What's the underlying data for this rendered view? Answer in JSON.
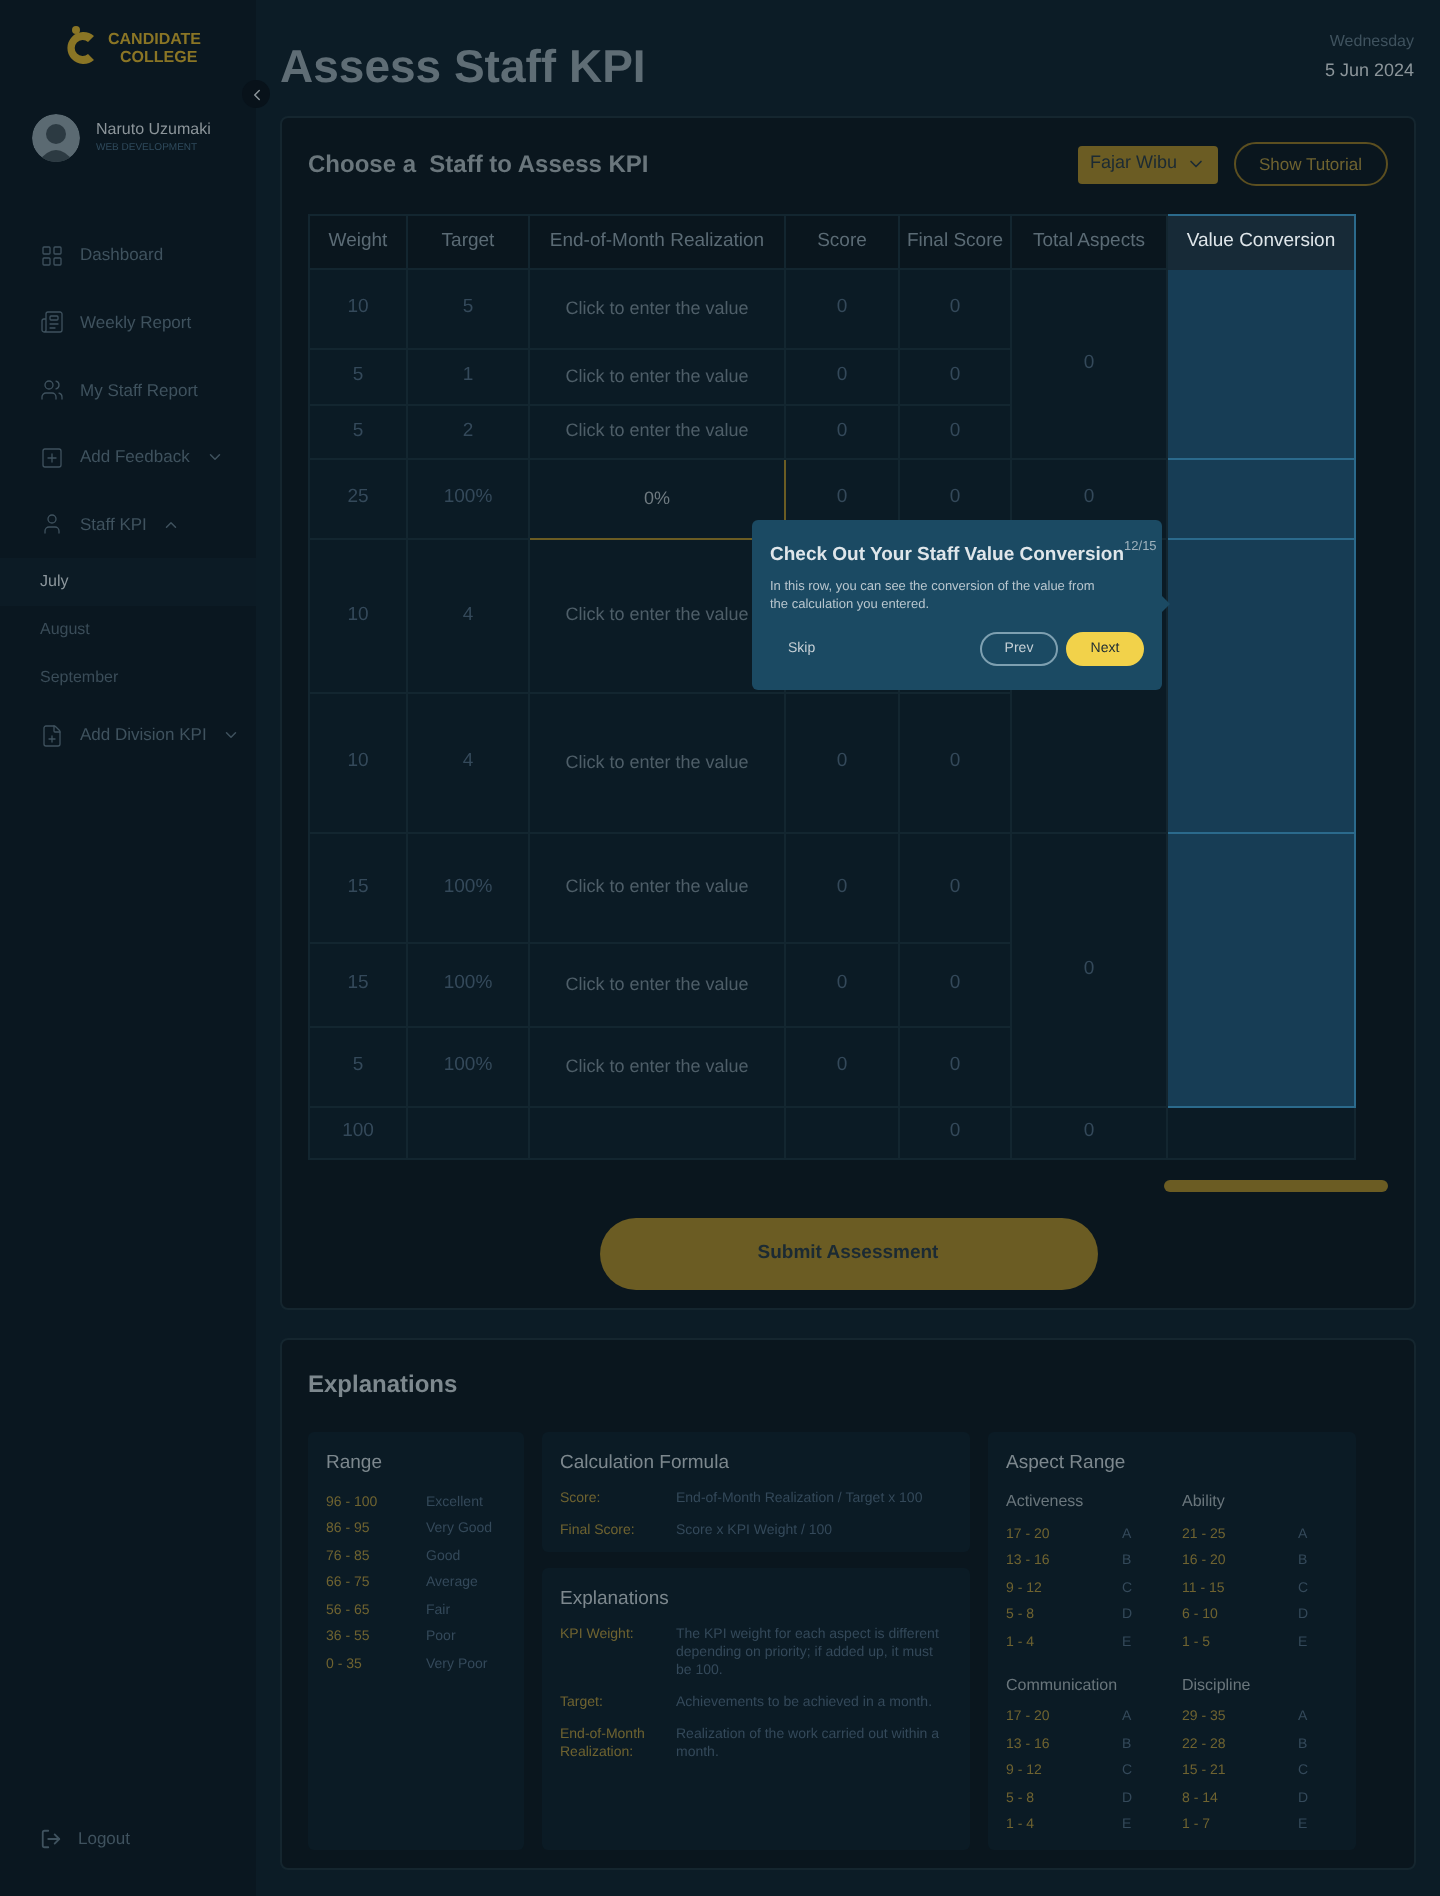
{
  "sidebar": {
    "logo": {
      "line1": "CANDIDATE",
      "line2": "COLLEGE"
    },
    "user": {
      "name": "Naruto Uzumaki",
      "role": "WEB DEVELOPMENT"
    },
    "nav": [
      {
        "kind": "link",
        "label": "Dashboard"
      },
      {
        "kind": "link",
        "label": "Weekly Report"
      },
      {
        "kind": "link",
        "label": "My Staff Report"
      },
      {
        "kind": "group",
        "label": "Add Feedback",
        "expanded": false
      },
      {
        "kind": "group",
        "label": "Staff KPI",
        "expanded": true,
        "children": [
          {
            "label": "July",
            "selected": true
          },
          {
            "label": "August",
            "selected": false
          },
          {
            "label": "September",
            "selected": false
          }
        ]
      },
      {
        "kind": "group",
        "label": "Add Division KPI",
        "expanded": false
      }
    ],
    "logout": "Logout"
  },
  "header": {
    "title": "Assess Staff KPI",
    "weekday": "Wednesday",
    "date": "5 Jun 2024"
  },
  "assess": {
    "title": "Choose a  Staff to Assess KPI",
    "staff_select": "Fajar Wibu",
    "tutorial_button": "Show Tutorial",
    "table": {
      "columns": [
        {
          "label": "Weight",
          "highlighted": false
        },
        {
          "label": "Target",
          "highlighted": false
        },
        {
          "label": "End-of-Month Realization",
          "highlighted": false
        },
        {
          "label": "Score",
          "highlighted": false
        },
        {
          "label": "Final Score",
          "highlighted": false
        },
        {
          "label": "Total Aspects",
          "highlighted": false
        },
        {
          "label": "Value Conversion",
          "highlighted": true
        }
      ],
      "groups": [
        {
          "total": "0",
          "rows": [
            {
              "weight": "10",
              "target": "5",
              "realization": "Click to enter the value",
              "focused": false,
              "score": "0",
              "final_score": "0"
            },
            {
              "weight": "5",
              "target": "1",
              "realization": "Click to enter the value",
              "focused": false,
              "score": "0",
              "final_score": "0"
            },
            {
              "weight": "5",
              "target": "2",
              "realization": "Click to enter the value",
              "focused": false,
              "score": "0",
              "final_score": "0"
            }
          ]
        },
        {
          "total": "0",
          "rows": [
            {
              "weight": "25",
              "target": "100%",
              "realization": "0%",
              "focused": true,
              "score": "0",
              "final_score": "0"
            }
          ]
        },
        {
          "rows": [
            {
              "weight": "10",
              "target": "4",
              "realization": "Click to enter the value",
              "focused": false
            },
            {
              "weight": "10",
              "target": "4",
              "realization": "Click to enter the value",
              "focused": false,
              "score": "0",
              "final_score": "0"
            }
          ]
        },
        {
          "total": "0",
          "rows": [
            {
              "weight": "15",
              "target": "100%",
              "realization": "Click to enter the value",
              "focused": false,
              "score": "0",
              "final_score": "0"
            },
            {
              "weight": "15",
              "target": "100%",
              "realization": "Click to enter the value",
              "focused": false,
              "score": "0",
              "final_score": "0"
            },
            {
              "weight": "5",
              "target": "100%",
              "realization": "Click to enter the value",
              "focused": false,
              "score": "0",
              "final_score": "0"
            }
          ]
        }
      ],
      "footer": {
        "weight": "100",
        "final_score": "0",
        "total": "0"
      }
    },
    "tooltip": {
      "title": "Check Out Your Staff Value Conversion",
      "step": "12/15",
      "body": "In this row, you can see the conversion of the value from the calculation you entered.",
      "skip": "Skip",
      "prev": "Prev",
      "next": "Next"
    },
    "submit": "Submit Assessment"
  },
  "explanations": {
    "title": "Explanations",
    "range": {
      "title": "Range",
      "rows": [
        {
          "range": "96 - 100",
          "label": "Excellent"
        },
        {
          "range": "86 - 95",
          "label": "Very Good"
        },
        {
          "range": "76 - 85",
          "label": "Good"
        },
        {
          "range": "66 - 75",
          "label": "Average"
        },
        {
          "range": "56 - 65",
          "label": "Fair"
        },
        {
          "range": "36 - 55",
          "label": "Poor"
        },
        {
          "range": "0 - 35",
          "label": "Very Poor"
        }
      ]
    },
    "formula": {
      "title": "Calculation Formula",
      "rows": [
        {
          "term": "Score:",
          "text": "End-of-Month Realization / Target x 100"
        },
        {
          "term": "Final Score:",
          "text": "Score x KPI Weight / 100"
        }
      ]
    },
    "glossary": {
      "title": "Explanations",
      "rows": [
        {
          "term": "KPI Weight:",
          "text": "The KPI weight for each aspect is different depending on priority; if added up, it must be 100."
        },
        {
          "term": "Target:",
          "text": "Achievements to be achieved in a month."
        },
        {
          "term": "End-of-Month Realization:",
          "text": "Realization of the work carried out within a month."
        }
      ]
    },
    "aspects": {
      "title": "Aspect Range",
      "groups": [
        {
          "name": "Activeness",
          "rows": [
            {
              "range": "17 - 20",
              "grade": "A"
            },
            {
              "range": "13 - 16",
              "grade": "B"
            },
            {
              "range": "9 - 12",
              "grade": "C"
            },
            {
              "range": "5 - 8",
              "grade": "D"
            },
            {
              "range": "1 - 4",
              "grade": "E"
            }
          ]
        },
        {
          "name": "Ability",
          "rows": [
            {
              "range": "21 - 25",
              "grade": "A"
            },
            {
              "range": "16 - 20",
              "grade": "B"
            },
            {
              "range": "11 - 15",
              "grade": "C"
            },
            {
              "range": "6 - 10",
              "grade": "D"
            },
            {
              "range": "1 - 5",
              "grade": "E"
            }
          ]
        },
        {
          "name": "Communication",
          "rows": [
            {
              "range": "17 - 20",
              "grade": "A"
            },
            {
              "range": "13 - 16",
              "grade": "B"
            },
            {
              "range": "9 - 12",
              "grade": "C"
            },
            {
              "range": "5 - 8",
              "grade": "D"
            },
            {
              "range": "1 - 4",
              "grade": "E"
            }
          ]
        },
        {
          "name": "Discipline",
          "rows": [
            {
              "range": "29 - 35",
              "grade": "A"
            },
            {
              "range": "22 - 28",
              "grade": "B"
            },
            {
              "range": "15 - 21",
              "grade": "C"
            },
            {
              "range": "8 - 14",
              "grade": "D"
            },
            {
              "range": "1 - 7",
              "grade": "E"
            }
          ]
        }
      ]
    }
  }
}
